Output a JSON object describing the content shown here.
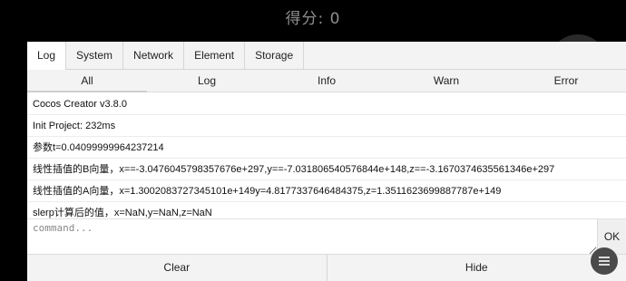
{
  "game": {
    "score_label": "得分: 0"
  },
  "tabs": [
    "Log",
    "System",
    "Network",
    "Element",
    "Storage"
  ],
  "filters": [
    "All",
    "Log",
    "Info",
    "Warn",
    "Error"
  ],
  "logs": [
    "Cocos Creator v3.8.0",
    "Init Project: 232ms",
    "参数t=0.04099999964237214",
    "线性插值的B向量，x==-3.0476045798357676e+297,y==-7.031806540576844e+148,z==-3.1670374635561346e+297",
    "线性插值的A向量，x=1.3002083727345101e+149y=4.8177337646484375,z=1.3511623699887787e+149",
    "slerp计算后的值，x=NaN,y=NaN,z=NaN"
  ],
  "command": {
    "placeholder": "command...",
    "value": ""
  },
  "ok_label": "OK",
  "clear_label": "Clear",
  "hide_label": "Hide"
}
